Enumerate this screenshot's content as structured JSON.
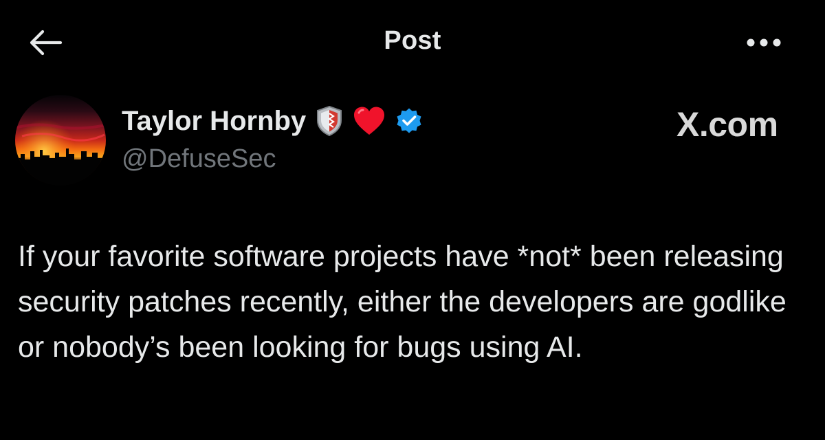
{
  "header": {
    "title": "Post",
    "back_icon": "arrow-left-icon",
    "more_icon": "ellipsis-horizontal-icon"
  },
  "author": {
    "display_name": "Taylor Hornby",
    "handle": "@DefuseSec",
    "badges": [
      "shield-icon",
      "red-heart-icon",
      "verified-badge-icon"
    ]
  },
  "watermark": "X.com",
  "post": {
    "text": "If your favorite software projects have *not* been releasing security patches recently, either the developers are godlike or nobody’s been looking for bugs using AI."
  },
  "colors": {
    "background": "#000000",
    "text_primary": "#e7e9ea",
    "text_secondary": "#71767b",
    "verified_blue": "#1d9bf0",
    "heart_red": "#f0132b"
  }
}
